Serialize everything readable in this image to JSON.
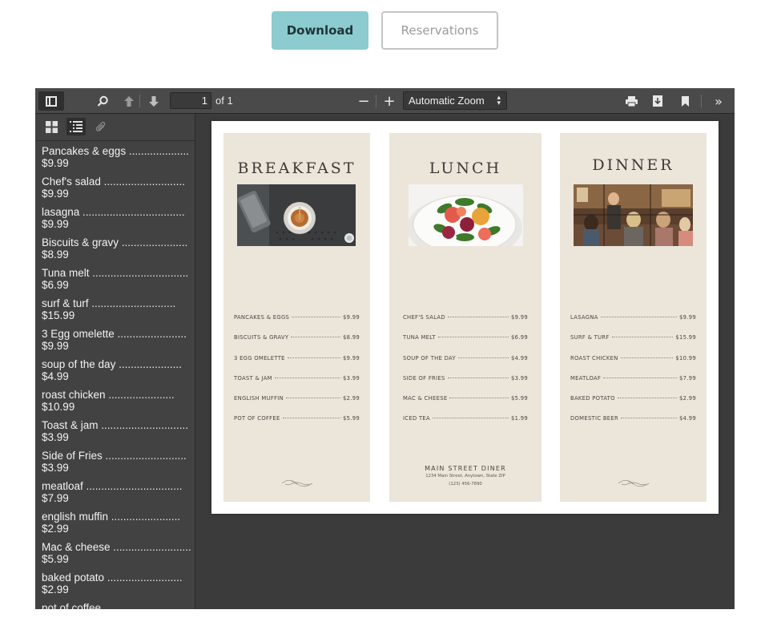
{
  "actions": {
    "download_label": "Download",
    "reservations_label": "Reservations"
  },
  "toolbar": {
    "page_number": "1",
    "page_of": "of 1",
    "zoom_label": "Automatic Zoom",
    "icons": [
      "sidebar-toggle-icon",
      "search-icon",
      "previous-page-icon",
      "next-page-icon",
      "zoom-out-icon",
      "zoom-in-icon",
      "print-icon",
      "download-icon",
      "bookmark-icon",
      "tools-icon"
    ]
  },
  "sidebar": {
    "tabs": [
      "thumbnails-icon",
      "outline-icon",
      "attachments-icon"
    ],
    "outline": [
      {
        "label": "Pancakes & eggs ....................",
        "price": "$9.99"
      },
      {
        "label": "Chef's salad ...........................",
        "price": "$9.99"
      },
      {
        "label": "lasagna ..................................",
        "price": "$9.99"
      },
      {
        "label": "Biscuits & gravy ......................",
        "price": "$8.99"
      },
      {
        "label": "Tuna melt ................................",
        "price": "$6.99"
      },
      {
        "label": "surf & turf ............................",
        "price": "$15.99"
      },
      {
        "label": "3 Egg omelette .......................",
        "price": "$9.99"
      },
      {
        "label": "soup of the day .....................",
        "price": "$4.99"
      },
      {
        "label": "roast chicken ......................",
        "price": "$10.99"
      },
      {
        "label": "Toast & jam .............................",
        "price": "$3.99"
      },
      {
        "label": "Side of Fries ...........................",
        "price": "$3.99"
      },
      {
        "label": "meatloaf ................................",
        "price": "$7.99"
      },
      {
        "label": "english muffin .......................",
        "price": "$2.99"
      },
      {
        "label": "Mac & cheese ..........................",
        "price": "$5.99"
      },
      {
        "label": "baked potato .........................",
        "price": "$2.99"
      },
      {
        "label": "pot of coffee",
        "price": ""
      }
    ]
  },
  "document": {
    "breakfast": {
      "title": "BREAKFAST",
      "items": [
        {
          "name": "PANCAKES & EGGS",
          "price": "$9.99"
        },
        {
          "name": "BISCUITS & GRAVY",
          "price": "$8.99"
        },
        {
          "name": "3 EGG OMELETTE",
          "price": "$9.99"
        },
        {
          "name": "TOAST & JAM",
          "price": "$3.99"
        },
        {
          "name": "ENGLISH MUFFIN",
          "price": "$2.99"
        },
        {
          "name": "POT OF COFFEE",
          "price": "$5.99"
        }
      ]
    },
    "lunch": {
      "title": "LUNCH",
      "items": [
        {
          "name": "CHEF'S SALAD",
          "price": "$9.99"
        },
        {
          "name": "TUNA MELT",
          "price": "$6.99"
        },
        {
          "name": "SOUP OF THE DAY",
          "price": "$4.99"
        },
        {
          "name": "SIDE OF FRIES",
          "price": "$3.99"
        },
        {
          "name": "MAC & CHEESE",
          "price": "$5.99"
        },
        {
          "name": "ICED TEA",
          "price": "$1.99"
        }
      ],
      "footer_name": "MAIN STREET DINER",
      "footer_address": "1234 Main Street, Anytown, State ZIP",
      "footer_phone": "(123) 456-7890"
    },
    "dinner": {
      "title": "DINNER",
      "items": [
        {
          "name": "LASAGNA",
          "price": "$9.99"
        },
        {
          "name": "SURF & TURF",
          "price": "$15.99"
        },
        {
          "name": "ROAST CHICKEN",
          "price": "$10.99"
        },
        {
          "name": "MEATLOAF",
          "price": "$7.99"
        },
        {
          "name": "BAKED POTATO",
          "price": "$2.99"
        },
        {
          "name": "DOMESTIC BEER",
          "price": "$4.99"
        }
      ]
    }
  },
  "colors": {
    "download_bg": "#8ccbcf",
    "viewer_bg": "#3b3b3b",
    "panel_bg": "#ece5da"
  }
}
